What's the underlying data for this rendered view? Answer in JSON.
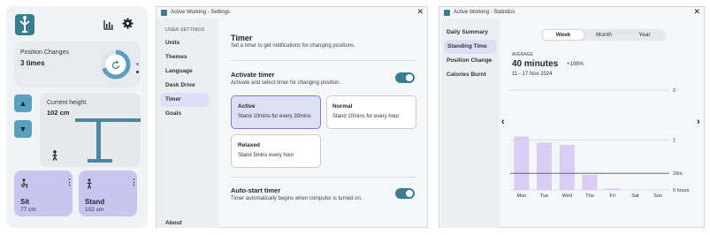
{
  "panel1": {
    "position_changes_label": "Position Changes",
    "position_changes_value": "3 times",
    "current_height_label": "Current height",
    "current_height_value": "102 cm",
    "sit_label": "Sit",
    "sit_value": "77 cm",
    "stand_label": "Stand",
    "stand_value": "102 cm",
    "progress_fraction": 0.7
  },
  "settings": {
    "window_title": "Active Working - Settings",
    "section_label": "USER SETTINGS",
    "sidebar_items": [
      "Units",
      "Themes",
      "Language",
      "Desk Drive",
      "Timer",
      "Goals"
    ],
    "about_label": "About",
    "timer_title": "Timer",
    "timer_subtitle": "Set a timer to get notifications for changing positions.",
    "activate_title": "Activate timer",
    "activate_desc": "Activate and select timer for changing position.",
    "options": [
      {
        "name": "Active",
        "desc": "Stand 10mins for every 30mins"
      },
      {
        "name": "Normal",
        "desc": "Stand 10mins for every hour"
      },
      {
        "name": "Relaxed",
        "desc": "Stand 5mins every hour"
      }
    ],
    "autostart_title": "Auto-start timer",
    "autostart_desc": "Timer automatically begins when computer is turned on.",
    "activate_on": true,
    "autostart_on": true
  },
  "statistics": {
    "window_title": "Active Working - Statistics",
    "sidebar_items": [
      "Daily Summary",
      "Standing Time",
      "Position Change",
      "Calories Burnt"
    ],
    "tabs": [
      "Week",
      "Month",
      "Year"
    ],
    "average_label": "AVERAGE",
    "average_value": "40 minutes",
    "change": "+108%",
    "date_range": "11 - 17 Nov 2024",
    "accent_color": "#d9ccf5",
    "goal_line_label": "20m"
  },
  "chart_data": {
    "type": "bar",
    "categories": [
      "Mon",
      "Tue",
      "Wed",
      "Thu",
      "Fri",
      "Sat",
      "Sun"
    ],
    "values": [
      1.07,
      0.95,
      0.9,
      0.3,
      0.03,
      0,
      0
    ],
    "y_tick_labels": [
      "2",
      "1",
      "0 hours"
    ],
    "ylim": [
      0,
      2
    ],
    "goal_line": 0.333,
    "grid": true
  }
}
